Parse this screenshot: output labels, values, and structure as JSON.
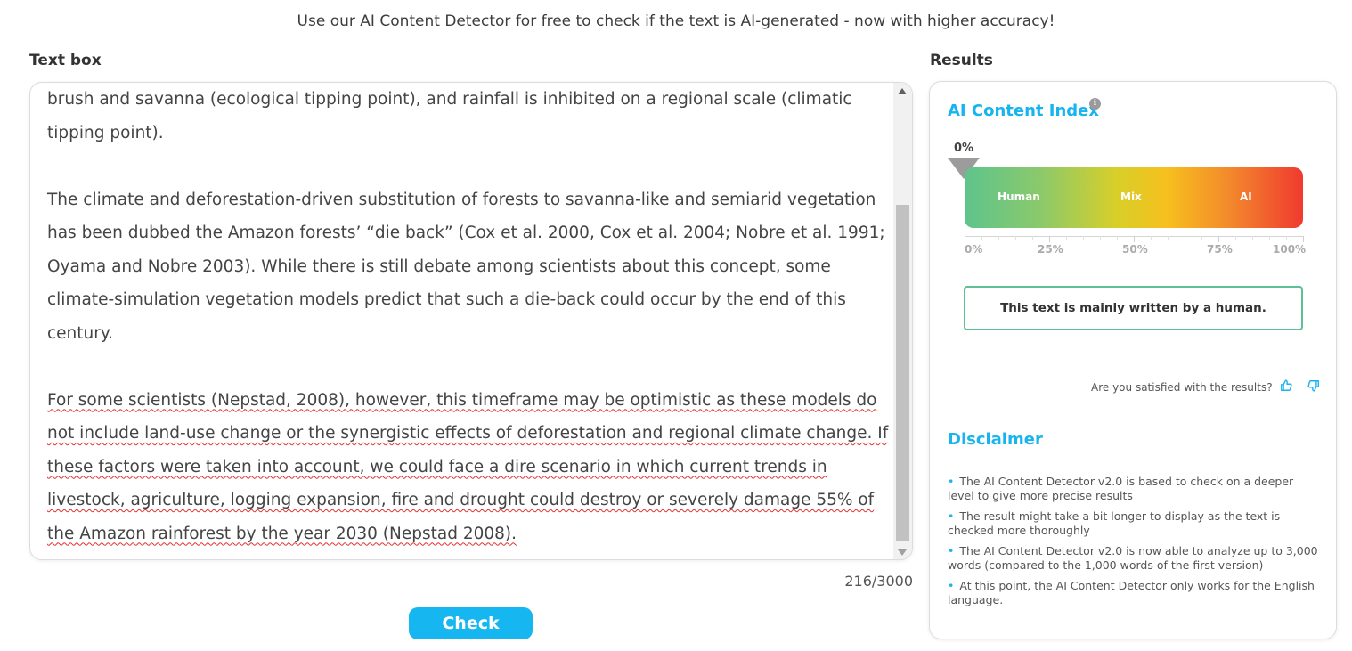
{
  "banner": "Use our AI Content Detector for free to check if the text is AI-generated - now with higher accuracy!",
  "textbox": {
    "label": "Text box",
    "para1": "brush and savanna (ecological tipping point), and rainfall is inhibited on a regional scale (climatic tipping point).",
    "para2": "The climate and deforestation-driven substitution of forests to savanna-like and semiarid vegetation has been dubbed the Amazon forests’ “die back” (Cox et al. 2000, Cox et al. 2004; Nobre et al. 1991; Oyama and Nobre 2003). While there is still debate among scientists about this concept, some climate-simulation vegetation models predict that such a die-back could occur by the end of this century.",
    "para3": "For some scientists (Nepstad, 2008), however, this timeframe may be optimistic as these models do not include land-use change or the synergistic effects of deforestation and regional climate change. If these factors were taken into account, we could face a dire scenario in which current trends in livestock, agriculture, logging expansion, fire and drought could destroy or severely damage 55% of the Amazon rainforest by the year 2030 (Nepstad 2008).",
    "counter": "216/3000"
  },
  "check_button": "Check",
  "results": {
    "label": "Results",
    "index_title": "AI Content Index",
    "info_icon": "i",
    "ai_percentage": "0%",
    "ai_fraction": 0,
    "gauge_labels": [
      "Human",
      "Mix",
      "AI"
    ],
    "scale_ticks": [
      "0%",
      "25%",
      "50%",
      "75%",
      "100%"
    ],
    "verdict": "This text is mainly written by a human.",
    "satisfied_prompt": "Are you satisfied with the results?",
    "colors": {
      "accent": "#17b4ef",
      "human": "#5ec48c",
      "mix": "#f7bf1e",
      "ai": "#ef3a2f",
      "verdict_border": "#5fbf95"
    }
  },
  "disclaimer": {
    "title": "Disclaimer",
    "items": [
      "The AI Content Detector v2.0 is based to check on a deeper level to give more precise results",
      "The result might take a bit longer to display as the text is checked more thoroughly",
      "The AI Content Detector v2.0 is now able to analyze up to 3,000 words (compared to the 1,000 words of the first version)",
      "At this point, the AI Content Detector only works for the English language."
    ]
  }
}
